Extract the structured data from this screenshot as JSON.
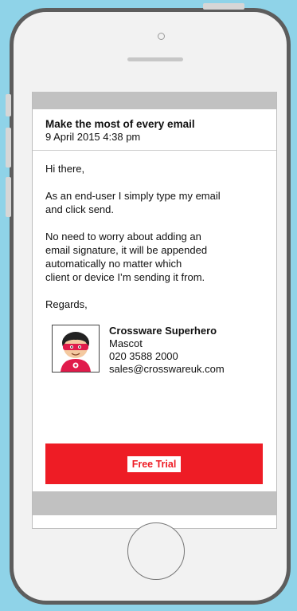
{
  "email": {
    "subject": "Make the most of every email",
    "date": "9 April 2015 4:38 pm",
    "greeting": "Hi there,",
    "paragraph1_line1": "As an end-user I simply type my email",
    "paragraph1_line2": "and click send.",
    "paragraph2_line1": "No need to worry about adding an",
    "paragraph2_line2": "email signature, it will be appended",
    "paragraph2_line3": "automatically no matter which",
    "paragraph2_line4": "client or device I’m sending it from.",
    "closing": "Regards,"
  },
  "signature": {
    "name": "Crossware Superhero",
    "title": "Mascot",
    "phone": "020 3588 2000",
    "email": "sales@crosswareuk.com",
    "avatar_icon": "superhero-mascot-icon"
  },
  "cta": {
    "label": "Free Trial",
    "color": "#ee1c25"
  },
  "colors": {
    "background": "#8fd3e8",
    "phone_frame": "#5d5d5d",
    "screen_bars": "#c1c1c1"
  }
}
